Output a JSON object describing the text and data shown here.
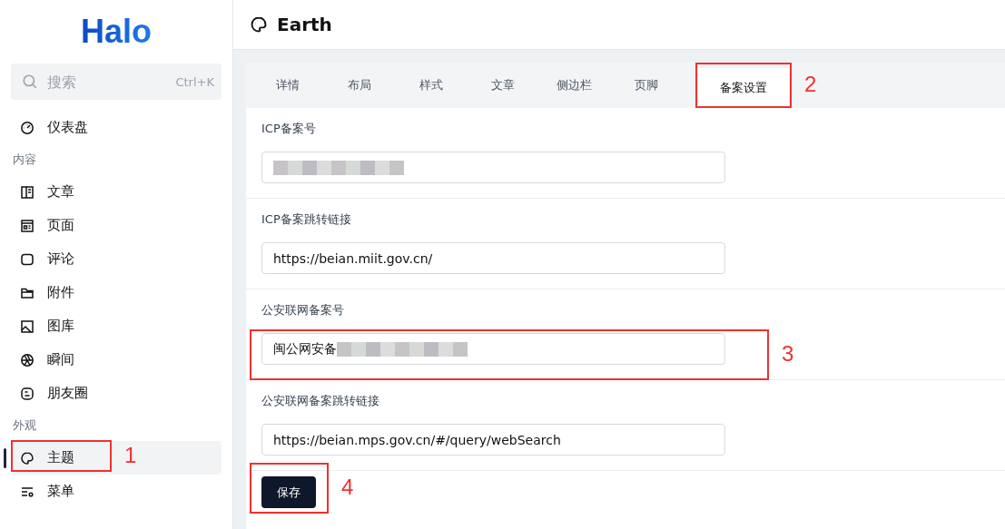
{
  "sidebar": {
    "logo": "Halo",
    "search": {
      "placeholder": "搜索",
      "shortcut": "Ctrl+K"
    },
    "groups": [
      {
        "items": [
          {
            "label": "仪表盘",
            "kind": "dashboard",
            "selected": false
          }
        ]
      },
      {
        "title": "内容",
        "items": [
          {
            "label": "文章",
            "kind": "post",
            "selected": false
          },
          {
            "label": "页面",
            "kind": "page",
            "selected": false
          },
          {
            "label": "评论",
            "kind": "comment",
            "selected": false
          },
          {
            "label": "附件",
            "kind": "folder",
            "selected": false
          },
          {
            "label": "图库",
            "kind": "image",
            "selected": false
          },
          {
            "label": "瞬间",
            "kind": "aperture",
            "selected": false
          },
          {
            "label": "朋友圈",
            "kind": "blog",
            "selected": false
          }
        ]
      },
      {
        "title": "外观",
        "items": [
          {
            "label": "主题",
            "kind": "palette",
            "selected": true,
            "annotation": "1"
          },
          {
            "label": "菜单",
            "kind": "menu",
            "selected": false
          }
        ]
      }
    ]
  },
  "header": {
    "title": "Earth"
  },
  "tabs": [
    {
      "label": "详情",
      "selected": false
    },
    {
      "label": "布局",
      "selected": false
    },
    {
      "label": "样式",
      "selected": false
    },
    {
      "label": "文章",
      "selected": false
    },
    {
      "label": "侧边栏",
      "selected": false
    },
    {
      "label": "页脚",
      "selected": false
    },
    {
      "label": "备案设置",
      "selected": true,
      "annotation": "2"
    }
  ],
  "fields": [
    {
      "label": "ICP备案号",
      "redacted": true
    },
    {
      "label": "ICP备案跳转链接",
      "value": "https://beian.miit.gov.cn/",
      "redacted": false
    },
    {
      "label": "公安联网备案号",
      "value": "闽公网安备",
      "redacted": true,
      "annotation": "3"
    },
    {
      "label": "公安联网备案跳转链接",
      "value": "https://beian.mps.gov.cn/#/query/webSearch",
      "redacted": false
    }
  ],
  "save_button": {
    "label": "保存",
    "annotation": "4"
  }
}
